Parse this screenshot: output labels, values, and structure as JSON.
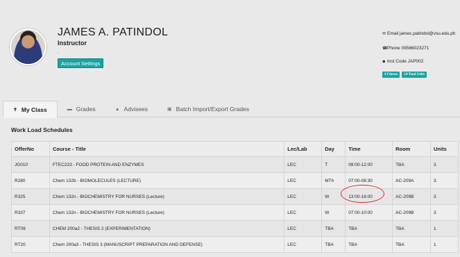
{
  "profile": {
    "name": "JAMES A. PATINDOL",
    "role": "Instructor",
    "dot": ".",
    "account_settings_label": "Account Settings"
  },
  "info": {
    "email": "Email james.patindol@vsu.edu.ph",
    "phone": "Phone 09566023271",
    "inst_code": "Inst Code JAP002",
    "badges": [
      "4 Classes",
      "14 Total Units"
    ]
  },
  "tabs": [
    {
      "label": "My Class",
      "icon": "pin-icon",
      "active": true
    },
    {
      "label": "Grades",
      "icon": "folder-icon"
    },
    {
      "label": "Advisees",
      "icon": "thumbs-up-icon"
    },
    {
      "label": "Batch Import/Export Grades",
      "icon": "image-icon"
    }
  ],
  "section_title": "Work Load Schedules",
  "table": {
    "headers": [
      "OfferNo",
      "Course - Title",
      "Lec/Lab",
      "Day",
      "Time",
      "Room",
      "Units"
    ],
    "rows": [
      [
        "JG010",
        "FTEC223 - FOOD PROTEIN AND ENZYMES",
        "LEC",
        "T",
        "09:00-12:00",
        "TBA",
        "3"
      ],
      [
        "R280",
        "Chem 132b - BIOMOLECULES (LECTURE)",
        "LEC",
        "MTh",
        "07:00-08:30",
        "AC-209A",
        "3"
      ],
      [
        "R325",
        "Chem 132n - BIOCHEMISTRY FOR NURSES (Lecture)",
        "LEC",
        "W",
        "13:00-16:00",
        "AC-209B",
        "3"
      ],
      [
        "R337",
        "Chem 132n - BIOCHEMISTRY FOR NURSES (Lecture)",
        "LEC",
        "W",
        "07:00-10:00",
        "AC-209B",
        "3"
      ],
      [
        "RT09",
        "CHEM 200a2 - THESIS 2 (EXPERIMENTATION)",
        "LEC",
        "TBA",
        "TBA",
        "TBA",
        "1"
      ],
      [
        "RT20",
        "Chem 200a3 - THESIS 3 (MANUSCRIPT PREPARATION AND DEFENSE)",
        "LEC",
        "TBA",
        "TBA",
        "TBA",
        "1"
      ]
    ]
  },
  "colors": {
    "accent": "#1aa3a3",
    "annotation": "#d23030"
  }
}
